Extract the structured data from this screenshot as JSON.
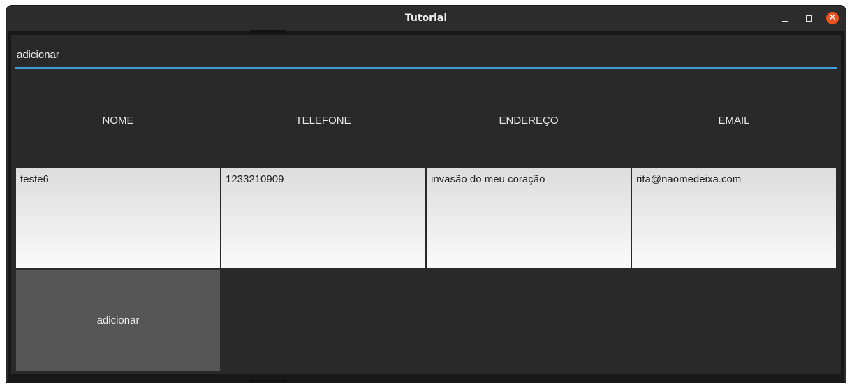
{
  "window": {
    "title": "Tutorial",
    "controls": {
      "minimize_icon": "minimize-icon",
      "maximize_icon": "maximize-icon",
      "close_icon": "close-icon",
      "close_color": "#e95420"
    }
  },
  "input": {
    "value": "adicionar",
    "accent_color": "#3d9dd6"
  },
  "table": {
    "headers": [
      "NOME",
      "TELEFONE",
      "ENDEREÇO",
      "EMAIL"
    ],
    "row": [
      "teste6",
      "1233210909",
      "invasão do meu coração",
      "rita@naomedeixa.com"
    ]
  },
  "add_button": {
    "label": "adicionar"
  }
}
